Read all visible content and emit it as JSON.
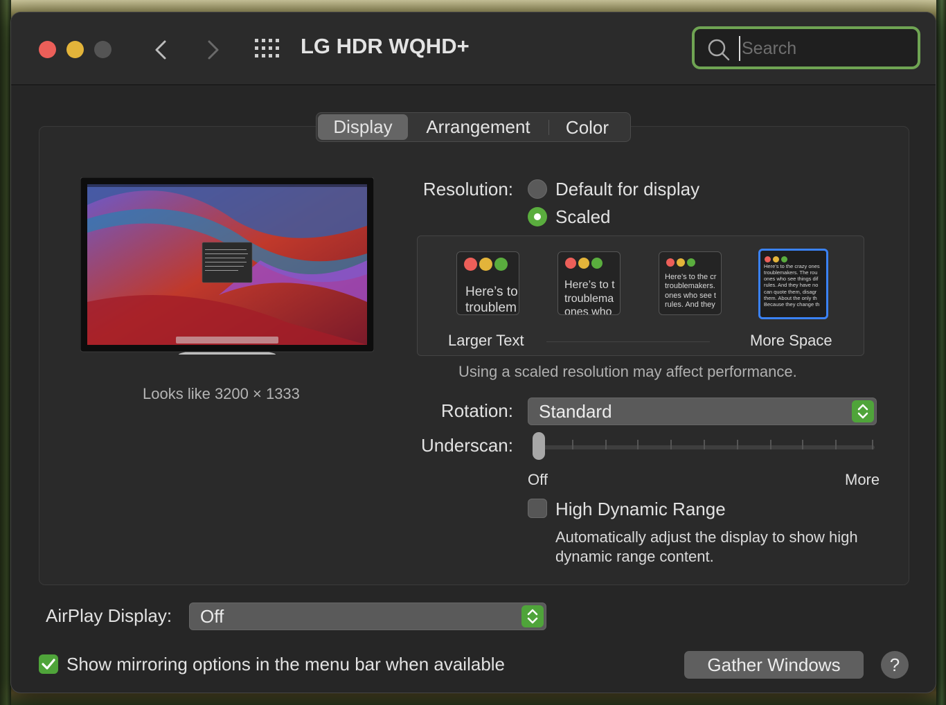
{
  "window": {
    "title": "LG HDR WQHD+",
    "search": {
      "placeholder": "Search",
      "value": ""
    }
  },
  "tabs": [
    {
      "label": "Display",
      "active": true
    },
    {
      "label": "Arrangement",
      "active": false
    },
    {
      "label": "Color",
      "active": false
    }
  ],
  "display": {
    "looks_like": "Looks like 3200 × 1333",
    "resolution": {
      "label": "Resolution:",
      "options": [
        {
          "label": "Default for display",
          "selected": false
        },
        {
          "label": "Scaled",
          "selected": true
        }
      ]
    },
    "scale_options": {
      "sample_text": "Here’s to the crazy ones. The misfits. The rebels. The troublemakers. The round pegs in the square holes. The ones who see things differently. They’re not fond of rules. And they have no respect for the status quo. You can quote them, disagree with them. About the only thing you can’t do is ignore them. Because they change things.",
      "larger_label": "Larger Text",
      "more_label": "More Space",
      "selected_index": 3,
      "thumbs": [
        {
          "lines": [
            "Here’s to",
            "troublem"
          ]
        },
        {
          "lines": [
            "Here’s to t",
            "troublema",
            "ones who"
          ]
        },
        {
          "lines": [
            "Here’s to the cr",
            "troublemakers.",
            "ones who see t",
            "rules. And they"
          ]
        },
        {
          "lines": [
            "Here's to the crazy ones",
            "troublemakers. The rou",
            "ones who see things dif",
            "rules. And they have no",
            "can quote them, disagr",
            "them. About the only th",
            "Because they change th"
          ]
        }
      ]
    },
    "scaled_warning": "Using a scaled resolution may affect performance.",
    "rotation": {
      "label": "Rotation:",
      "value": "Standard"
    },
    "underscan": {
      "label": "Underscan:",
      "min_label": "Off",
      "max_label": "More",
      "value": 0
    },
    "hdr": {
      "label": "High Dynamic Range",
      "checked": false,
      "description": "Automatically adjust the display to show high dynamic range content."
    }
  },
  "airplay": {
    "label": "AirPlay Display:",
    "value": "Off"
  },
  "mirroring": {
    "label": "Show mirroring options in the menu bar when available",
    "checked": true
  },
  "buttons": {
    "gather": "Gather Windows",
    "help": "?"
  },
  "colors": {
    "accent_green": "#4fa43a",
    "selection_blue": "#3a82f7",
    "close_red": "#ec5f59",
    "minimize_yellow": "#e3b43a"
  }
}
